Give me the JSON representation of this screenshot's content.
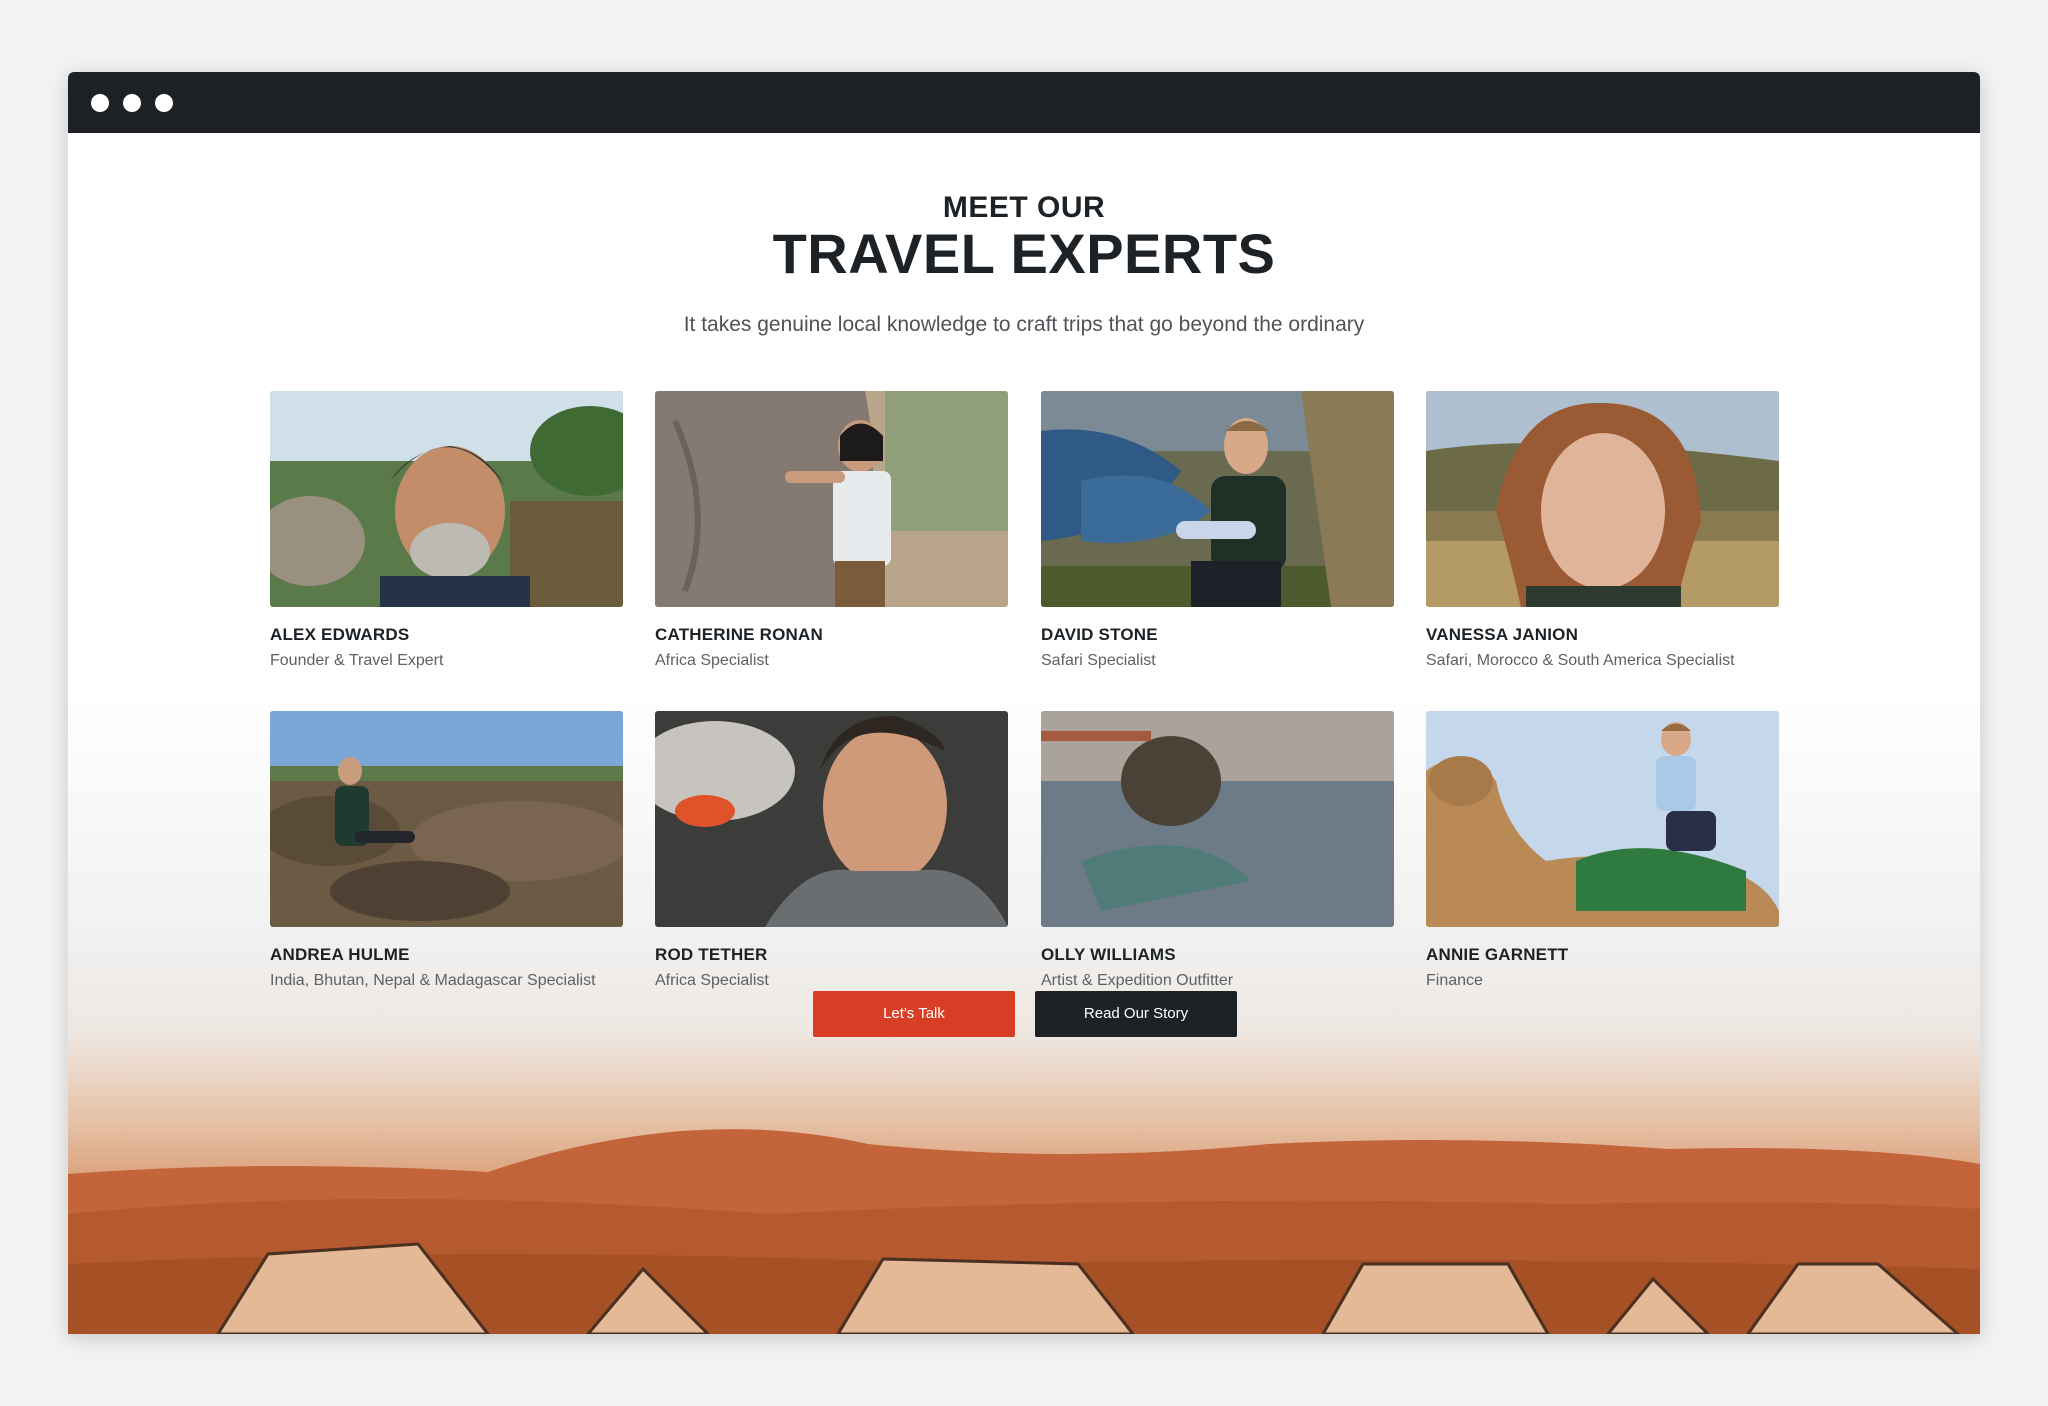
{
  "page": {
    "kicker": "MEET OUR",
    "headline": "TRAVEL EXPERTS",
    "subtitle": "It takes genuine local knowledge to craft trips that go beyond the ordinary"
  },
  "team": [
    {
      "name": "ALEX EDWARDS",
      "role": "Founder & Travel Expert"
    },
    {
      "name": "CATHERINE RONAN",
      "role": "Africa Specialist"
    },
    {
      "name": "DAVID STONE",
      "role": "Safari Specialist"
    },
    {
      "name": "VANESSA JANION",
      "role": "Safari, Morocco & South America Specialist"
    },
    {
      "name": "ANDREA HULME",
      "role": "India, Bhutan, Nepal & Madagascar Specialist"
    },
    {
      "name": "ROD TETHER",
      "role": "Africa Specialist"
    },
    {
      "name": "OLLY WILLIAMS",
      "role": "Artist & Expedition Outfitter"
    },
    {
      "name": "ANNIE GARNETT",
      "role": "Finance"
    }
  ],
  "buttons": {
    "talk_label": "Let's Talk",
    "story_label": "Read Our Story"
  },
  "colors": {
    "accent": "#d83d26",
    "dark": "#1e2226"
  }
}
